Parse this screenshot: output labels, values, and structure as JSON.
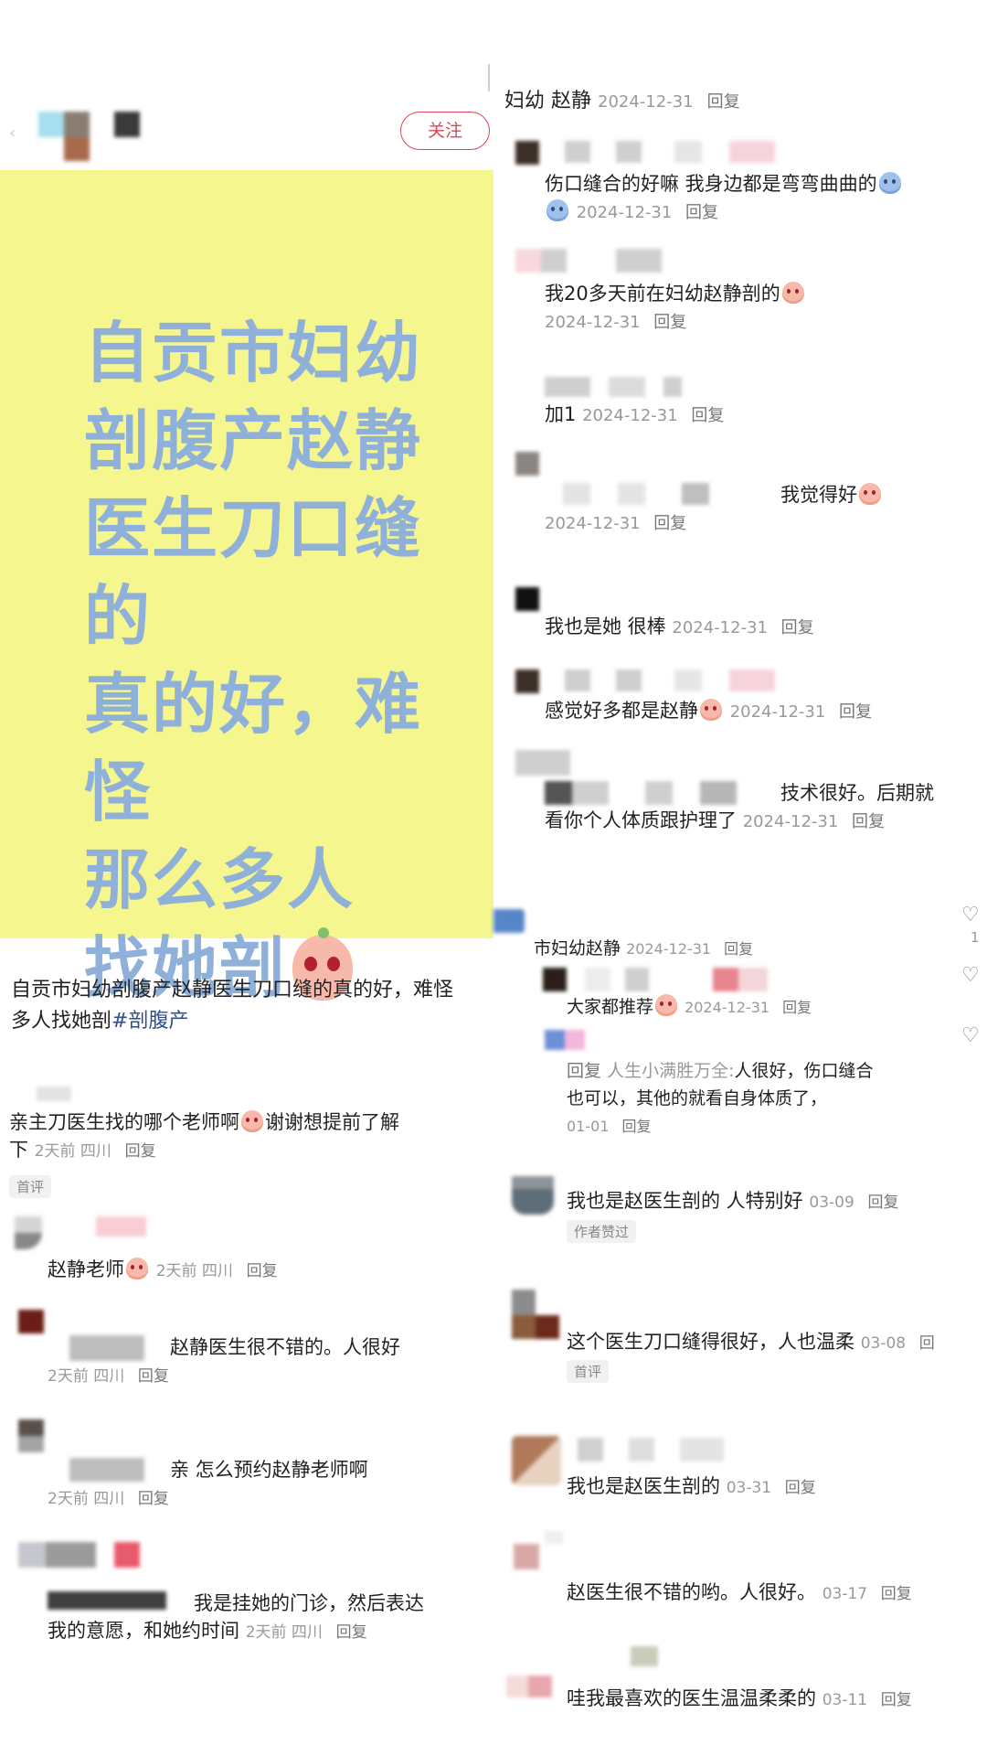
{
  "left": {
    "follow_button": "关注",
    "poster_text_lines": [
      "自贡市妇幼",
      "剖腹产赵静",
      "医生刀口缝的",
      "真的好，难怪",
      "那么多人",
      "找她剖"
    ],
    "caption_line1": "自贡市妇幼剖腹产赵静医生刀口缝的真的好，难怪",
    "caption_line2_prefix": "多人找她剖",
    "caption_hashtag": "#剖腹产",
    "comments": [
      {
        "line1": "亲主刀医生找的哪个老师啊",
        "line1b": "谢谢想提前了解",
        "line2": "下",
        "meta": "2天前 四川",
        "reply": "回复",
        "badge": "首评"
      },
      {
        "text": "赵静老师",
        "meta": "2天前 四川",
        "reply": "回复"
      },
      {
        "text": "赵静医生很不错的。人很好",
        "meta": "2天前 四川",
        "reply": "回复"
      },
      {
        "text": "亲  怎么预约赵静老师啊",
        "meta": "2天前 四川",
        "reply": "回复"
      },
      {
        "line1": "我是挂她的门诊，然后表达",
        "line2": "我的意愿，和她约时间",
        "meta": "2天前 四川",
        "reply": "回复"
      }
    ]
  },
  "right_top": {
    "header_name": "妇幼 赵静",
    "header_date": "2024-12-31",
    "header_reply": "回复",
    "comments": [
      {
        "text": "伤口缝合的好嘛 我身边都是弯弯曲曲的",
        "date": "2024-12-31",
        "reply": "回复"
      },
      {
        "text": "我20多天前在妇幼赵静剖的",
        "date": "2024-12-31",
        "reply": "回复"
      },
      {
        "text": "加1",
        "date": "2024-12-31",
        "reply": "回复"
      },
      {
        "text": "我觉得好",
        "date": "2024-12-31",
        "reply": "回复"
      },
      {
        "text": "我也是她 很棒",
        "date": "2024-12-31",
        "reply": "回复"
      },
      {
        "text": "感觉好多都是赵静",
        "date": "2024-12-31",
        "reply": "回复"
      },
      {
        "line1": "技术很好。后期就",
        "line2": "看你个人体质跟护理了",
        "date": "2024-12-31",
        "reply": "回复"
      }
    ]
  },
  "right_bottom": {
    "header_name": "市妇幼赵静",
    "header_date": "2024-12-31",
    "header_reply": "回复",
    "comments": [
      {
        "text": "大家都推荐",
        "date": "2024-12-31",
        "reply": "回复"
      },
      {
        "reply_prefix": "回复",
        "reply_to": "人生小满胜万全:",
        "line1": "人很好，伤口缝合",
        "line2": "也可以，其他的就看自身体质了，",
        "date": "01-01",
        "reply": "回复"
      },
      {
        "text": "我也是赵医生剖的 人特别好",
        "date": "03-09",
        "reply": "回复",
        "badge": "作者赞过"
      },
      {
        "text": "这个医生刀口缝得很好，人也温柔",
        "date": "03-08",
        "reply": "回",
        "badge": "首评"
      },
      {
        "text": "我也是赵医生剖的",
        "date": "03-31",
        "reply": "回复"
      },
      {
        "text": "赵医生很不错的哟。人很好。",
        "date": "03-17",
        "reply": "回复"
      },
      {
        "text": "哇我最喜欢的医生温温柔柔的",
        "date": "03-11",
        "reply": "回复"
      }
    ],
    "edge_like_count": "1"
  },
  "colors": {
    "poster_bg": "#f5f78e",
    "poster_text": "#8fb0d8",
    "hashtag": "#2b4f8f",
    "follow_red": "#e0455a"
  }
}
